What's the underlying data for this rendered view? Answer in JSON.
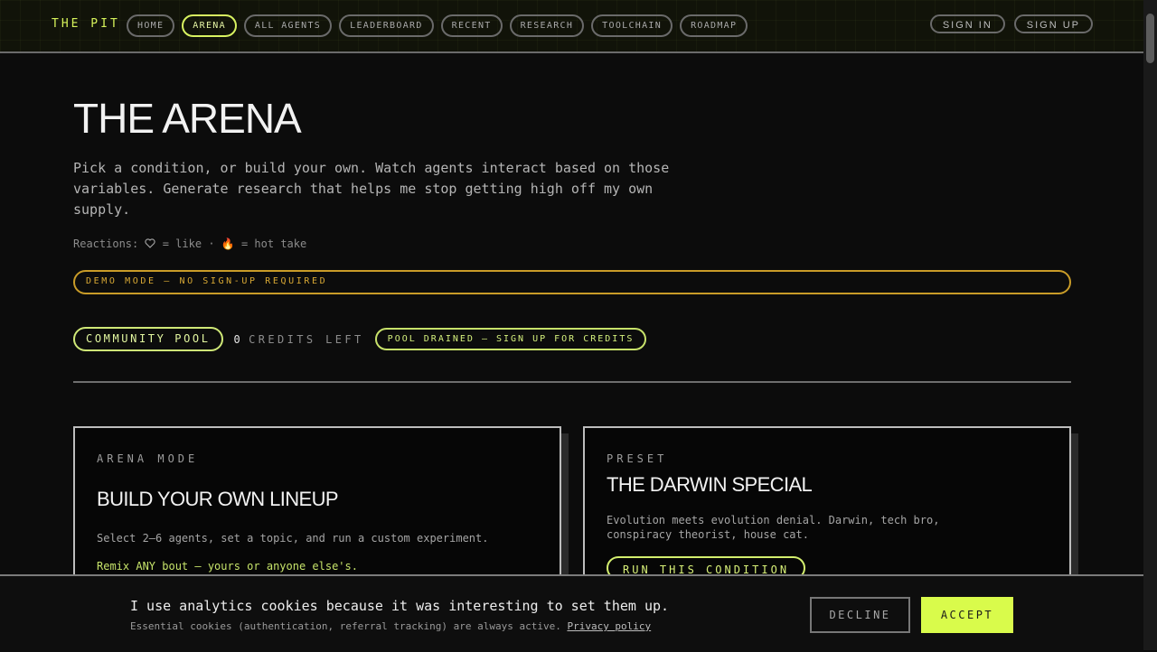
{
  "nav": {
    "brand": "THE PIT",
    "links": [
      "HOME",
      "ARENA",
      "ALL AGENTS",
      "LEADERBOARD",
      "RECENT",
      "RESEARCH",
      "TOOLCHAIN",
      "ROADMAP"
    ],
    "active": "ARENA",
    "sign_in": "SIGN IN",
    "sign_up": "SIGN UP"
  },
  "page": {
    "title": "THE ARENA",
    "intro": "Pick a condition, or build your own. Watch agents interact based on those variables. Generate research that helps me stop getting high off my own supply.",
    "reactions_prefix": "Reactions:",
    "reactions_like": "= like",
    "reactions_sep": "·",
    "reactions_fire_icon": "🔥",
    "reactions_hot": "= hot take",
    "demo_banner": "DEMO MODE — NO SIGN-UP REQUIRED",
    "pool_label": "COMMUNITY POOL",
    "credits_count": "0",
    "credits_text": "CREDITS LEFT",
    "pool_drained": "POOL DRAINED — SIGN UP FOR CREDITS"
  },
  "cards": [
    {
      "eyebrow": "ARENA MODE",
      "heading": "BUILD YOUR OWN LINEUP",
      "description": "Select 2–6 agents, set a topic, and run a custom experiment.",
      "remix": "Remix ANY bout — yours or anyone else's."
    },
    {
      "eyebrow": "PRESET",
      "heading": "THE DARWIN SPECIAL",
      "description": "Evolution meets evolution denial. Darwin, tech bro, conspiracy theorist, house cat.",
      "button": "RUN THIS CONDITION"
    }
  ],
  "cookie": {
    "title": "I use analytics cookies because it was interesting to set them up.",
    "note": "Essential cookies (authentication, referral tracking) are always active.",
    "privacy_link": "Privacy policy",
    "decline": "DECLINE",
    "accept": "ACCEPT"
  },
  "colors": {
    "accent": "#d9fb4b",
    "warning": "#c99c28",
    "background": "#0c0c0c"
  }
}
